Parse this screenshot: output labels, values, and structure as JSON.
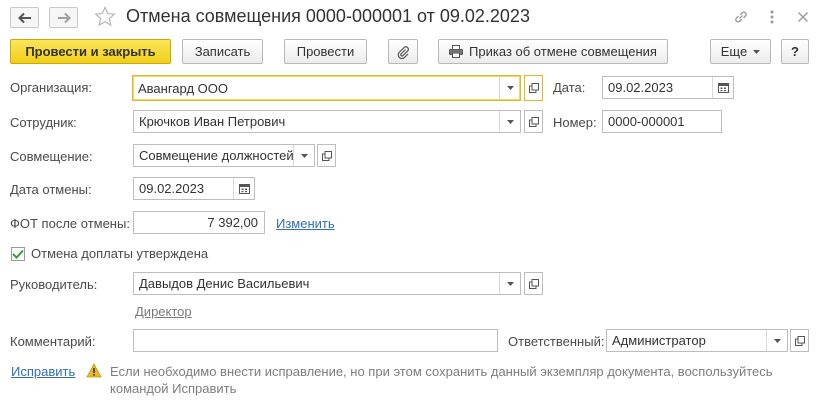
{
  "window": {
    "title": "Отмена совмещения 0000-000001 от 09.02.2023"
  },
  "toolbar": {
    "post_and_close": "Провести и закрыть",
    "save": "Записать",
    "post": "Провести",
    "order_print": "Приказ об отмене совмещения",
    "more": "Еще",
    "help": "?"
  },
  "form": {
    "organization": {
      "label": "Организация:",
      "value": "Авангард ООО"
    },
    "date": {
      "label": "Дата:",
      "value": "09.02.2023"
    },
    "employee": {
      "label": "Сотрудник:",
      "value": "Крючков Иван Петрович"
    },
    "number": {
      "label": "Номер:",
      "value": "0000-000001"
    },
    "combination": {
      "label": "Совмещение:",
      "value": "Совмещение должностей"
    },
    "cancel_date": {
      "label": "Дата отмены:",
      "value": "09.02.2023"
    },
    "fot": {
      "label": "ФОТ после отмены:",
      "value": "7 392,00",
      "change_link": "Изменить"
    },
    "surcharge_approved": {
      "label": "Отмена доплаты утверждена",
      "checked": true
    },
    "manager": {
      "label": "Руководитель:",
      "value": "Давыдов Денис Васильевич",
      "position": "Директор"
    },
    "comment": {
      "label": "Комментарий:",
      "value": ""
    },
    "responsible": {
      "label": "Ответственный:",
      "value": "Администратор"
    }
  },
  "footer": {
    "fix_link": "Исправить",
    "warning": "Если необходимо внести исправление, но при этом сохранить данный экземпляр документа, воспользуйтесь командой Исправить"
  },
  "colors": {
    "accent_yellow": "#f2cf1a",
    "link_blue": "#2f6fb2",
    "check_green": "#3a9a3a",
    "warning_yellow": "#e8b923"
  }
}
